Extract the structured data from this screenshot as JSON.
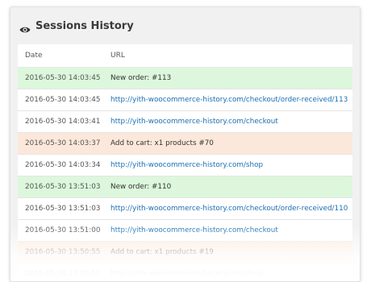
{
  "panel": {
    "title": "Sessions History",
    "icon": "eye-icon"
  },
  "table": {
    "columns": [
      "Date",
      "URL"
    ],
    "rows": [
      {
        "date": "2016-05-30 14:03:45",
        "url": "New order: #113",
        "kind": "order"
      },
      {
        "date": "2016-05-30 14:03:45",
        "url": "http://yith-woocommerce-history.com/checkout/order-received/113",
        "kind": "page"
      },
      {
        "date": "2016-05-30 14:03:41",
        "url": "http://yith-woocommerce-history.com/checkout",
        "kind": "page"
      },
      {
        "date": "2016-05-30 14:03:37",
        "url": "Add to cart: x1 products #70",
        "kind": "cart"
      },
      {
        "date": "2016-05-30 14:03:34",
        "url": "http://yith-woocommerce-history.com/shop",
        "kind": "page"
      },
      {
        "date": "2016-05-30 13:51:03",
        "url": "New order: #110",
        "kind": "order"
      },
      {
        "date": "2016-05-30 13:51:03",
        "url": "http://yith-woocommerce-history.com/checkout/order-received/110",
        "kind": "page"
      },
      {
        "date": "2016-05-30 13:51:00",
        "url": "http://yith-woocommerce-history.com/checkout",
        "kind": "page"
      },
      {
        "date": "2016-05-30 13:50:55",
        "url": "Add to cart: x1 products #19",
        "kind": "cart"
      },
      {
        "date": "2016-05-30 13:50:52",
        "url": "http://yith-woocommerce-history.com/shop",
        "kind": "page"
      }
    ]
  },
  "colors": {
    "order_row": "#dcf7dc",
    "cart_row": "#fce8da",
    "link": "#1a6fb2"
  }
}
